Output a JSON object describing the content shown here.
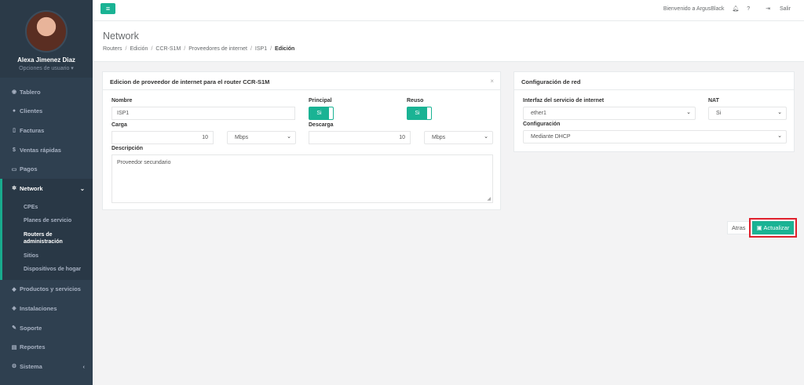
{
  "user": {
    "name": "Alexa Jimenez Diaz",
    "options": "Opciones de usuario ▾"
  },
  "nav": {
    "tablero": "Tablero",
    "clientes": "Clientes",
    "facturas": "Facturas",
    "ventas": "Ventas rápidas",
    "pagos": "Pagos",
    "network": "Network",
    "network_sub": [
      "CPEs",
      "Planes de servicio",
      "Routers de administración",
      "Sitios",
      "Dispositivos de hogar"
    ],
    "productos": "Productos y servicios",
    "instalaciones": "Instalaciones",
    "soporte": "Soporte",
    "reportes": "Reportes",
    "sistema": "Sistema"
  },
  "topbar": {
    "welcome": "Bienvenido a ArgusBlack",
    "logout": "Salir"
  },
  "page": {
    "title": "Network",
    "breadcrumbs": [
      "Routers",
      "Edición",
      "CCR-S1M",
      "Proveedores de internet",
      "ISP1",
      "Edición"
    ]
  },
  "provider_panel": {
    "title": "Edicion de proveedor de internet para el router CCR-S1M",
    "close": "×",
    "nombre_label": "Nombre",
    "nombre_value": "ISP1",
    "principal_label": "Principal",
    "principal_value": "Si",
    "reuso_label": "Reuso",
    "reuso_value": "Si",
    "carga_label": "Carga",
    "carga_value": "10",
    "carga_unit": "Mbps",
    "descarga_label": "Descarga",
    "descarga_value": "10",
    "descarga_unit": "Mbps",
    "descripcion_label": "Descripción",
    "descripcion_value": "Proveedor secundario"
  },
  "network_panel": {
    "title": "Configuración de red",
    "interfaz_label": "Interfaz del servicio de internet",
    "interfaz_value": "ether1",
    "nat_label": "NAT",
    "nat_value": "Si",
    "config_label": "Configuración",
    "config_value": "Mediante DHCP"
  },
  "actions": {
    "back": "Atras",
    "update": "Actualizar"
  },
  "colors": {
    "accent": "#1ab394",
    "sidebar": "#2f4050",
    "highlight": "#e0202c"
  }
}
